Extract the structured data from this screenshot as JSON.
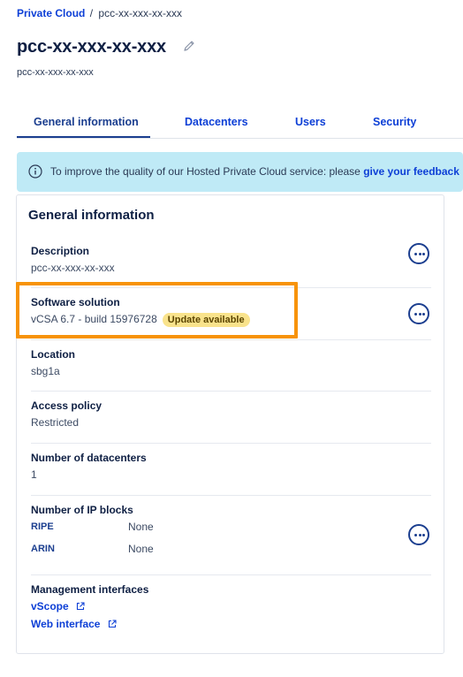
{
  "breadcrumb": {
    "root": "Private Cloud",
    "separator": "/",
    "current": "pcc-xx-xxx-xx-xxx"
  },
  "header": {
    "title": "pcc-xx-xxx-xx-xxx",
    "subtitle": "pcc-xx-xxx-xx-xxx"
  },
  "tabs": [
    {
      "label": "General information",
      "active": true
    },
    {
      "label": "Datacenters",
      "active": false
    },
    {
      "label": "Users",
      "active": false
    },
    {
      "label": "Security",
      "active": false
    }
  ],
  "banner": {
    "icon": "info-icon",
    "text": "To improve the quality of our Hosted Private Cloud service: please ",
    "link": "give your feedback"
  },
  "card": {
    "title": "General information",
    "description": {
      "label": "Description",
      "value": "pcc-xx-xxx-xx-xxx"
    },
    "software": {
      "label": "Software solution",
      "value": "vCSA 6.7 - build 15976728",
      "badge": "Update available"
    },
    "location": {
      "label": "Location",
      "value": "sbg1a"
    },
    "access_policy": {
      "label": "Access policy",
      "value": "Restricted"
    },
    "datacenters": {
      "label": "Number of datacenters",
      "value": "1"
    },
    "ip_blocks": {
      "label": "Number of IP blocks",
      "items": [
        {
          "key": "RIPE",
          "value": "None"
        },
        {
          "key": "ARIN",
          "value": "None"
        }
      ]
    },
    "management": {
      "label": "Management interfaces",
      "links": [
        "vScope",
        "Web interface"
      ]
    }
  },
  "colors": {
    "accent": "#0d3fd6",
    "navy": "#1b3e8f",
    "banner_bg": "#bfeaf6",
    "badge_bg": "#f9e38c",
    "highlight": "#f7930a"
  }
}
